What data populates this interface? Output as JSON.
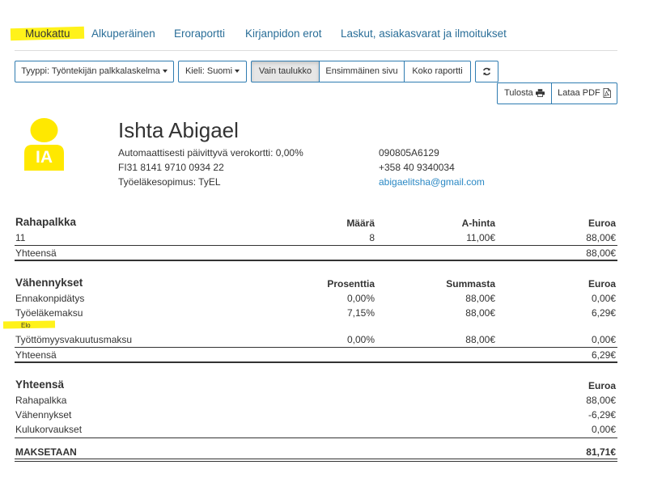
{
  "tabs": [
    {
      "label": "Muokattu"
    },
    {
      "label": "Alkuperäinen"
    },
    {
      "label": "Eroraportti"
    },
    {
      "label": "Kirjanpidon erot"
    },
    {
      "label": "Laskut, asiakasvarat ja ilmoitukset"
    }
  ],
  "toolbar": {
    "type_dropdown": "Tyyppi: Työntekijän palkkalaskelma",
    "language_dropdown": "Kieli: Suomi",
    "view_options": [
      "Vain taulukko",
      "Ensimmäinen sivu",
      "Koko raportti"
    ],
    "print_label": "Tulosta",
    "download_label": "Lataa PDF"
  },
  "employee": {
    "initials": "IA",
    "name": "Ishta Abigael",
    "tax_card": "Automaattisesti päivittyvä verokortti: 0,00%",
    "iban": "FI31 8141 9710 0934 22",
    "pension": "Työeläkesopimus: TyEL",
    "id_code": "090805A6129",
    "phone": "+358 40 9340034",
    "email": "abigaelitsha@gmail.com"
  },
  "salary": {
    "title": "Rahapalkka",
    "headers": [
      "Määrä",
      "A-hinta",
      "Euroa"
    ],
    "rows": [
      {
        "label": "11",
        "amount": "8",
        "unit_price": "11,00€",
        "total": "88,00€"
      }
    ],
    "total_label": "Yhteensä",
    "total_value": "88,00€"
  },
  "deductions": {
    "title": "Vähennykset",
    "headers": [
      "Prosenttia",
      "Summasta",
      "Euroa"
    ],
    "rows": [
      {
        "label": "Ennakonpidätys",
        "percent": "0,00%",
        "base": "88,00€",
        "total": "0,00€"
      },
      {
        "label": "Työeläkemaksu",
        "percent": "7,15%",
        "base": "88,00€",
        "total": "6,29€"
      },
      {
        "label": "Työttömyysvakuutusmaksu",
        "percent": "0,00%",
        "base": "88,00€",
        "total": "0,00€"
      }
    ],
    "note": "Elo",
    "total_label": "Yhteensä",
    "total_value": "6,29€"
  },
  "summary": {
    "title": "Yhteensä",
    "header": "Euroa",
    "rows": [
      {
        "label": "Rahapalkka",
        "value": "88,00€"
      },
      {
        "label": "Vähennykset",
        "value": "-6,29€"
      },
      {
        "label": "Kulukorvaukset",
        "value": "0,00€"
      }
    ],
    "pay_label": "MAKSETAAN",
    "pay_value": "81,71€"
  },
  "colors": {
    "highlight": "#fff21a",
    "link": "#2a6e98",
    "avatar": "#ffe800",
    "button_border": "#2f7cb1"
  }
}
